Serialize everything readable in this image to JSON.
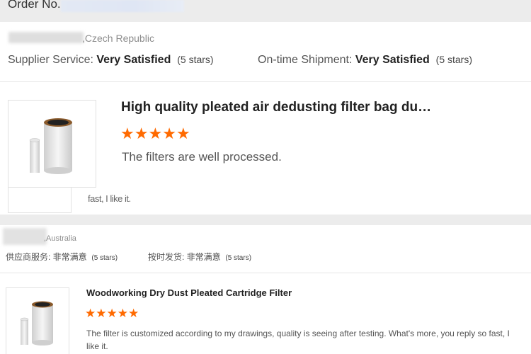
{
  "order": {
    "label": "Order No."
  },
  "review1": {
    "country": ",Czech Republic",
    "supplier_service_label": "Supplier Service: ",
    "supplier_service_value": "Very Satisfied",
    "supplier_service_stars": "(5 stars)",
    "shipment_label": "On-time Shipment: ",
    "shipment_value": "Very Satisfied",
    "shipment_stars": "(5 stars)",
    "product_title": "High quality pleated air dedusting filter bag du…",
    "rating": 5,
    "text": "The filters are well processed.",
    "overflow_text": "fast, I like it."
  },
  "review2": {
    "country": ",Australia",
    "supplier_service_label": "供应商服务: ",
    "supplier_service_value": "非常满意",
    "supplier_service_stars": "(5 stars)",
    "shipment_label": "按时发货: ",
    "shipment_value": "非常满意",
    "shipment_stars": "(5 stars)",
    "product_title": "Woodworking Dry Dust Pleated Cartridge Filter",
    "rating": 5,
    "text": "The filter is customized according to my drawings, quality is seeing after testing. What's more, you reply so fast, I like it."
  },
  "colors": {
    "star": "#ff6a00",
    "band": "#ececec"
  }
}
